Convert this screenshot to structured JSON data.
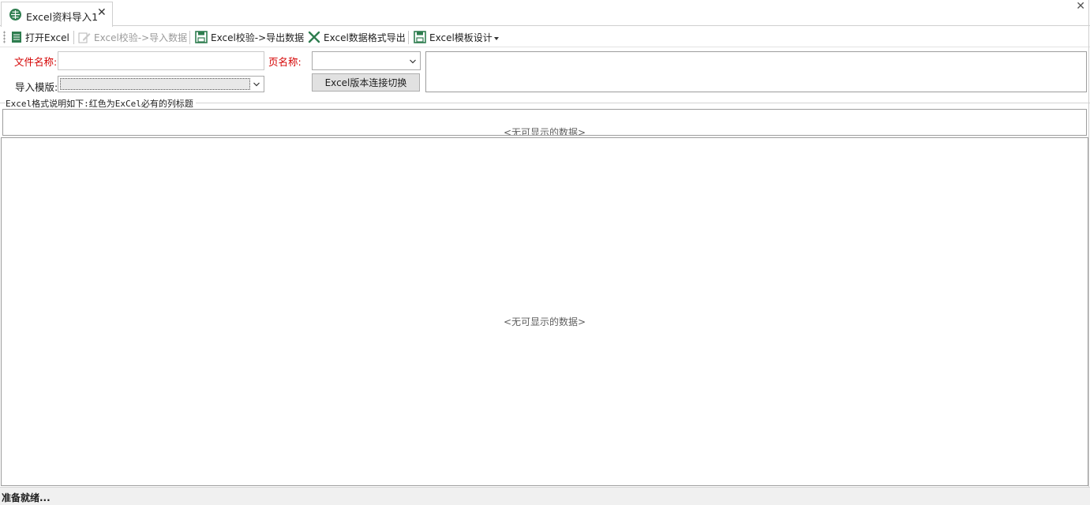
{
  "tab": {
    "title": "Excel资料导入1",
    "close": "✕",
    "icon": "grid-globe-icon"
  },
  "window": {
    "close": "✕"
  },
  "toolbar": {
    "open_excel": "打开Excel",
    "validate_import": "Excel校验->导入数据",
    "validate_export": "Excel校验->导出数据",
    "format_export": "Excel数据格式导出",
    "template_design": "Excel模板设计"
  },
  "form": {
    "file_name_label": "文件名称:",
    "file_name_value": "",
    "sheet_name_label": "页名称:",
    "sheet_name_value": "",
    "template_label": "导入模版:",
    "template_value": "",
    "switch_button": "Excel版本连接切换"
  },
  "format_group": {
    "caption": "Excel格式说明如下:红色为ExCel必有的列标题",
    "empty_text": "<无可显示的数据>"
  },
  "main_grid": {
    "empty_text": "<无可显示的数据>"
  },
  "status": {
    "text": "准备就绪..."
  },
  "colors": {
    "required_label": "#d40000",
    "icon_green": "#2e7d4f"
  }
}
